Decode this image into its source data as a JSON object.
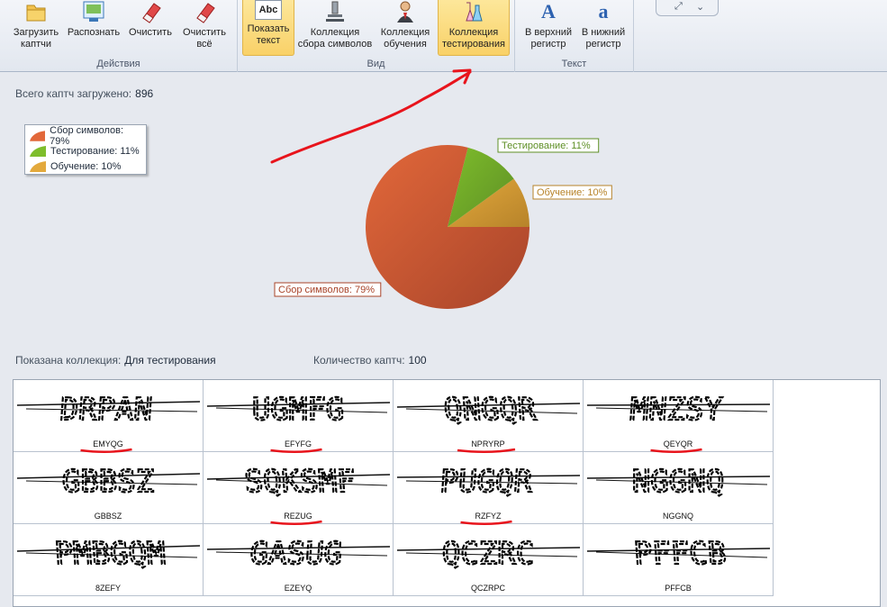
{
  "ribbon": {
    "groups": [
      {
        "label": "Действия"
      },
      {
        "label": "Вид"
      },
      {
        "label": "Текст"
      }
    ],
    "buttons": {
      "load": {
        "line1": "Загрузить",
        "line2": "каптчи",
        "icon": "folder-icon"
      },
      "recognize": {
        "line1": "Распознать",
        "line2": "",
        "icon": "recognize-icon"
      },
      "clear": {
        "line1": "Очистить",
        "line2": "",
        "icon": "eraser-icon"
      },
      "clear_all": {
        "line1": "Очистить",
        "line2": "всё",
        "icon": "eraser-icon"
      },
      "show_text": {
        "line1": "Показать",
        "line2": "текст",
        "icon": "abc-icon",
        "icon_text": "Abc",
        "active": true
      },
      "symbols": {
        "line1": "Коллекция",
        "line2": "сбора символов",
        "icon": "microscope-icon"
      },
      "training": {
        "line1": "Коллекция",
        "line2": "обучения",
        "icon": "teacher-icon"
      },
      "testing": {
        "line1": "Коллекция",
        "line2": "тестирования",
        "icon": "flasks-icon",
        "active": true
      },
      "upper": {
        "line1": "В верхний",
        "line2": "регистр",
        "icon": "uppercase-icon",
        "icon_text": "A"
      },
      "lower": {
        "line1": "В нижний",
        "line2": "регистр",
        "icon": "lowercase-icon",
        "icon_text": "a"
      }
    },
    "collapse": {
      "expand_glyph": "⤢",
      "chevron_glyph": "⌄"
    }
  },
  "stats": {
    "total_label": "Всего каптч загружено:",
    "total_value": "896"
  },
  "legend": [
    {
      "label": "Сбор символов: 79%",
      "color": "#e2683a"
    },
    {
      "label": "Тестирование: 11%",
      "color": "#7ebd2b"
    },
    {
      "label": "Обучение: 10%",
      "color": "#e3a93c"
    }
  ],
  "chart_data": {
    "type": "pie",
    "slices": [
      {
        "label": "Сбор символов: 79%",
        "value": 79,
        "color": "#e2683a",
        "border": "#a8442a"
      },
      {
        "label": "Тестирование: 11%",
        "value": 11,
        "color": "#7ebd2b",
        "border": "#5e8f25"
      },
      {
        "label": "Обучение: 10%",
        "value": 10,
        "color": "#e3a93c",
        "border": "#b7832a"
      }
    ]
  },
  "collection": {
    "label": "Показана коллекция:",
    "value": "Для тестирования",
    "count_label": "Количество каптч:",
    "count_value": "100"
  },
  "captchas": [
    {
      "text": "EMYQG",
      "image_letters": "DRPAN",
      "underlined": true
    },
    {
      "text": "EFYFG",
      "image_letters": "UGMFG",
      "underlined": true
    },
    {
      "text": "NPRYRP",
      "image_letters": "QNGQR",
      "underlined": true
    },
    {
      "text": "QEYQR",
      "image_letters": "MNZSY",
      "underlined": true
    },
    {
      "text": "GBBSZ",
      "image_letters": "GBBSZ",
      "underlined": false
    },
    {
      "text": "REZUG",
      "image_letters": "SQKSMF",
      "underlined": true
    },
    {
      "text": "RZFYZ",
      "image_letters": "PUGQR",
      "underlined": true
    },
    {
      "text": "NGGNQ",
      "image_letters": "NGGNQ",
      "underlined": false
    },
    {
      "text": "8ZEFY",
      "image_letters": "PMBGQM",
      "underlined": false
    },
    {
      "text": "EZEYQ",
      "image_letters": "GASUG",
      "underlined": false
    },
    {
      "text": "QCZRPC",
      "image_letters": "QCZRC",
      "underlined": false
    },
    {
      "text": "PFFCB",
      "image_letters": "PFFCB",
      "underlined": false
    }
  ],
  "annotation_color": "#e8141c"
}
